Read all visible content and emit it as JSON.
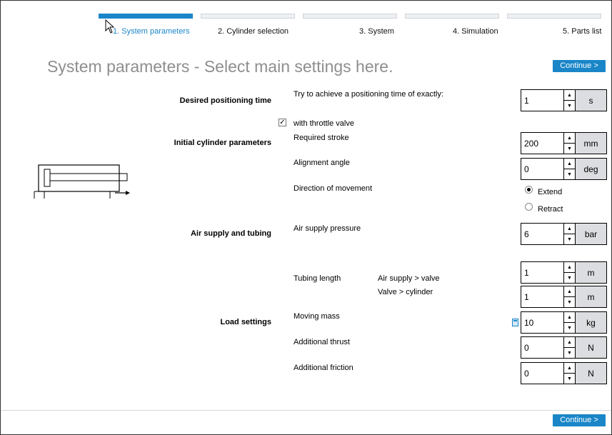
{
  "steps": [
    {
      "label": "1. System parameters",
      "active": true
    },
    {
      "label": "2. Cylinder selection",
      "active": false
    },
    {
      "label": "3. System",
      "active": false
    },
    {
      "label": "4. Simulation",
      "active": false
    },
    {
      "label": "5. Parts list",
      "active": false
    }
  ],
  "title": "System parameters - Select main settings here.",
  "continue_label": "Continue >",
  "sections": {
    "positioning": "Desired positioning time",
    "cylinder": "Initial cylinder parameters",
    "air": "Air supply and tubing",
    "load": "Load settings"
  },
  "labels": {
    "positioning_time": "Try to achieve a positioning time of exactly:",
    "throttle": "with throttle valve",
    "stroke": "Required stroke",
    "angle": "Alignment angle",
    "direction": "Direction of movement",
    "extend": "Extend",
    "retract": "Retract",
    "pressure": "Air supply pressure",
    "tubing": "Tubing length",
    "tube1": "Air supply > valve",
    "tube2": "Valve > cylinder",
    "mass": "Moving mass",
    "thrust": "Additional thrust",
    "friction": "Additional friction"
  },
  "fields": {
    "time": {
      "value": "1",
      "unit": "s"
    },
    "stroke": {
      "value": "200",
      "unit": "mm"
    },
    "angle": {
      "value": "0",
      "unit": "deg"
    },
    "pressure": {
      "value": "6",
      "unit": "bar"
    },
    "tube1": {
      "value": "1",
      "unit": "m"
    },
    "tube2": {
      "value": "1",
      "unit": "m"
    },
    "mass": {
      "value": "10",
      "unit": "kg"
    },
    "thrust": {
      "value": "0",
      "unit": "N"
    },
    "friction": {
      "value": "0",
      "unit": "N"
    }
  },
  "state": {
    "throttle_checked": true,
    "direction": "Extend"
  },
  "colors": {
    "accent": "#1a86c8",
    "unit_bg": "#dcdde0",
    "title": "#8e8e8e"
  }
}
